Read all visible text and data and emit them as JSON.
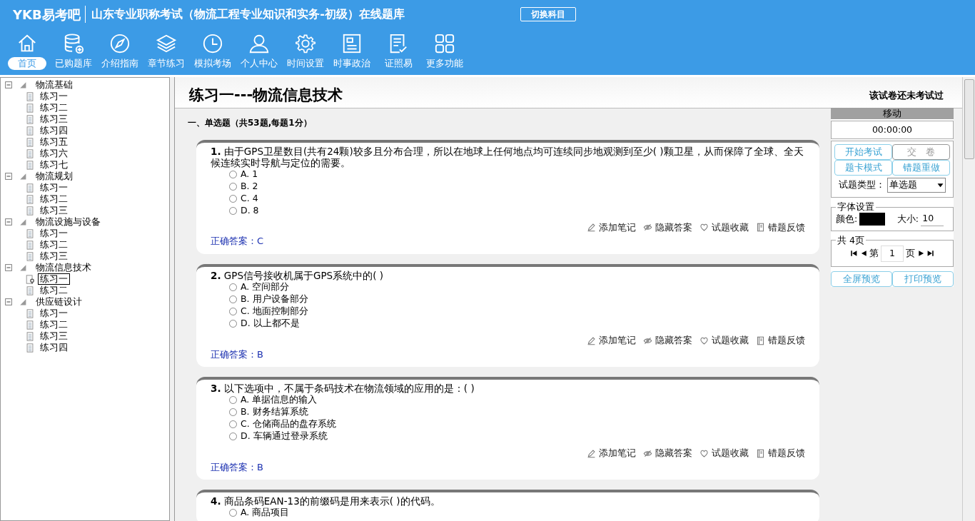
{
  "header": {
    "logo": "YKB易考吧",
    "title": "山东专业职称考试（物流工程专业知识和实务-初级）在线题库",
    "switch_button": "切换科目"
  },
  "nav": [
    {
      "label": "首页",
      "kind": "home",
      "selected": true
    },
    {
      "label": "已购题库",
      "kind": "database",
      "selected": false
    },
    {
      "label": "介绍指南",
      "kind": "compass",
      "selected": false
    },
    {
      "label": "章节练习",
      "kind": "layers",
      "selected": false
    },
    {
      "label": "模拟考场",
      "kind": "clock",
      "selected": false
    },
    {
      "label": "个人中心",
      "kind": "user",
      "selected": false
    },
    {
      "label": "时间设置",
      "kind": "gear",
      "selected": false
    },
    {
      "label": "时事政治",
      "kind": "news",
      "selected": false
    },
    {
      "label": "证照易",
      "kind": "checklist",
      "selected": false
    },
    {
      "label": "更多功能",
      "kind": "grid",
      "selected": false
    }
  ],
  "tree": [
    {
      "label": "物流基础",
      "expanded": true,
      "children": [
        {
          "label": "练习一",
          "selected": false
        },
        {
          "label": "练习二",
          "selected": false
        },
        {
          "label": "练习三",
          "selected": false
        },
        {
          "label": "练习四",
          "selected": false
        },
        {
          "label": "练习五",
          "selected": false
        },
        {
          "label": "练习六",
          "selected": false
        },
        {
          "label": "练习七",
          "selected": false
        }
      ]
    },
    {
      "label": "物流规划",
      "expanded": true,
      "children": [
        {
          "label": "练习一",
          "selected": false
        },
        {
          "label": "练习二",
          "selected": false
        },
        {
          "label": "练习三",
          "selected": false
        }
      ]
    },
    {
      "label": "物流设施与设备",
      "expanded": true,
      "children": [
        {
          "label": "练习一",
          "selected": false
        },
        {
          "label": "练习二",
          "selected": false
        },
        {
          "label": "练习三",
          "selected": false
        }
      ]
    },
    {
      "label": "物流信息技术",
      "expanded": true,
      "children": [
        {
          "label": "练习一",
          "selected": true
        },
        {
          "label": "练习二",
          "selected": false
        }
      ]
    },
    {
      "label": "供应链设计",
      "expanded": true,
      "children": [
        {
          "label": "练习一",
          "selected": false
        },
        {
          "label": "练习二",
          "selected": false
        },
        {
          "label": "练习三",
          "selected": false
        },
        {
          "label": "练习四",
          "selected": false
        }
      ]
    }
  ],
  "paper": {
    "title": "练习一---物流信息技术",
    "status": "该试卷还未考试过",
    "section": "一、单选题（共53题,每题1分）"
  },
  "questions": [
    {
      "number": "1.",
      "text": "由于GPS卫星数目(共有24颗)较多且分布合理，所以在地球上任何地点均可连续同步地观测到至少( )颗卫星，从而保障了全球、全天候连续实时导航与定位的需要。",
      "options": [
        {
          "label": "A. 1",
          "selected": false
        },
        {
          "label": "B. 2",
          "selected": false
        },
        {
          "label": "C. 4",
          "selected": false
        },
        {
          "label": "D. 8",
          "selected": false
        }
      ],
      "actions": [
        "添加笔记",
        "隐藏答案",
        "试题收藏",
        "错题反馈"
      ],
      "answer": "正确答案：C"
    },
    {
      "number": "2.",
      "text": "GPS信号接收机属于GPS系统中的( )",
      "options": [
        {
          "label": "A. 空间部分",
          "selected": false
        },
        {
          "label": "B. 用户设备部分",
          "selected": false
        },
        {
          "label": "C. 地面控制部分",
          "selected": false
        },
        {
          "label": "D. 以上都不是",
          "selected": false
        }
      ],
      "actions": [
        "添加笔记",
        "隐藏答案",
        "试题收藏",
        "错题反馈"
      ],
      "answer": "正确答案：B"
    },
    {
      "number": "3.",
      "text": "以下选项中，不属于条码技术在物流领域的应用的是：( )",
      "options": [
        {
          "label": "A. 单据信息的输入",
          "selected": false
        },
        {
          "label": "B. 财务结算系统",
          "selected": false
        },
        {
          "label": "C. 仓储商品的盘存系统",
          "selected": false
        },
        {
          "label": "D. 车辆通过登录系统",
          "selected": false
        }
      ],
      "actions": [
        "添加笔记",
        "隐藏答案",
        "试题收藏",
        "错题反馈"
      ],
      "answer": "正确答案：B"
    },
    {
      "number": "4.",
      "text": "商品条码EAN-13的前缀码是用来表示( )的代码。",
      "options": [
        {
          "label": "A. 商品项目",
          "selected": false
        }
      ]
    }
  ],
  "panel": {
    "handle": "移动",
    "timer": "00:00:00",
    "buttons": [
      {
        "label": "开始考试",
        "disabled": false
      },
      {
        "label": "交　卷",
        "disabled": true
      },
      {
        "label": "题卡模式",
        "disabled": false
      },
      {
        "label": "错题重做",
        "disabled": false
      }
    ],
    "type_label": "试题类型：",
    "type_value": "单选题",
    "font_legend": "字体设置",
    "color_label": "颜色:",
    "color": "#000000",
    "size_label": "大小:",
    "size_value": "10",
    "page_legend": "共 4页",
    "page_prefix": "第",
    "page_value": "1",
    "page_suffix": "页",
    "bottom_buttons": [
      "全屏预览",
      "打印预览"
    ]
  }
}
